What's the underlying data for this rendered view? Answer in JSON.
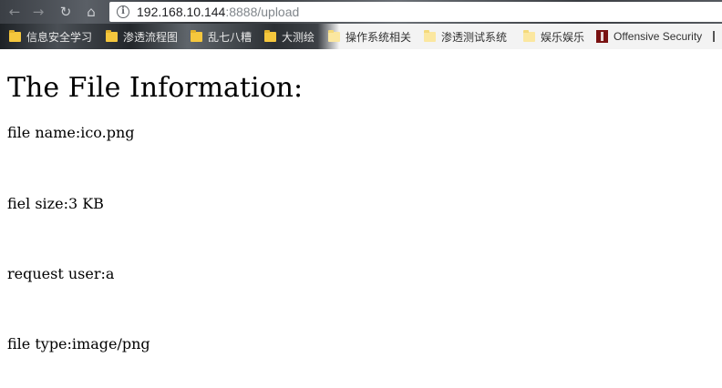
{
  "browser": {
    "address_bar": {
      "url_host": "192.168.10.144",
      "url_rest": ":8888/upload"
    },
    "nav": {
      "back_icon": "back-arrow-icon",
      "forward_icon": "forward-arrow-icon",
      "reload_icon": "reload-icon",
      "home_icon": "home-icon"
    },
    "bookmarks": [
      {
        "label": "信息安全学习",
        "icon": "folder-icon"
      },
      {
        "label": "渗透流程图",
        "icon": "folder-icon"
      },
      {
        "label": "乱七八糟",
        "icon": "folder-icon"
      },
      {
        "label": "大测绘",
        "icon": "folder-icon"
      },
      {
        "label": "操作系统相关",
        "icon": "folder-icon"
      },
      {
        "label": "渗透测试系统",
        "icon": "folder-icon"
      },
      {
        "label": "娱乐娱乐",
        "icon": "folder-icon"
      },
      {
        "label": "Offensive Security",
        "icon": "offensive-security-icon"
      }
    ]
  },
  "page": {
    "heading": "The File Information:",
    "file_name": "file name:ico.png",
    "file_size": "fiel size:3 KB",
    "request_user": "request user:a",
    "file_type": "file type:image/png"
  }
}
